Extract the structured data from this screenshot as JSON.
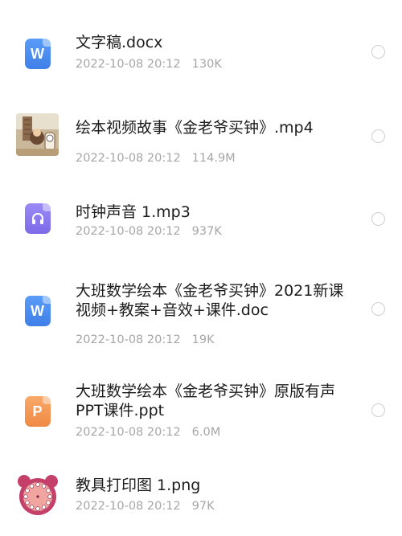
{
  "files": [
    {
      "name": "文字稿.docx",
      "date": "2022-10-08 20:12",
      "size": "130K",
      "icon": "word-icon",
      "icon_letter": "W"
    },
    {
      "name": "绘本视频故事《金老爷买钟》.mp4",
      "date": "2022-10-08 20:12",
      "size": "114.9M",
      "icon": "video-thumbnail"
    },
    {
      "name": "时钟声音 1.mp3",
      "date": "2022-10-08 20:12",
      "size": "937K",
      "icon": "headphones-icon"
    },
    {
      "name": "大班数学绘本《金老爷买钟》2021新课 视频+教案+音效+课件.doc",
      "date": "2022-10-08 20:12",
      "size": "19K",
      "icon": "word-icon",
      "icon_letter": "W"
    },
    {
      "name": "大班数学绘本《金老爷买钟》原版有声 PPT课件.ppt",
      "date": "2022-10-08 20:12",
      "size": "6.0M",
      "icon": "powerpoint-icon",
      "icon_letter": "P"
    },
    {
      "name": "教具打印图 1.png",
      "date": "2022-10-08 20:12",
      "size": "97K",
      "icon": "clock-image-thumbnail"
    }
  ],
  "colors": {
    "word": "#4a8cf5",
    "audio": "#8a78f0",
    "ppt": "#f39a56",
    "meta_text": "#a6a6a6",
    "name_text": "#1c1c1c"
  }
}
